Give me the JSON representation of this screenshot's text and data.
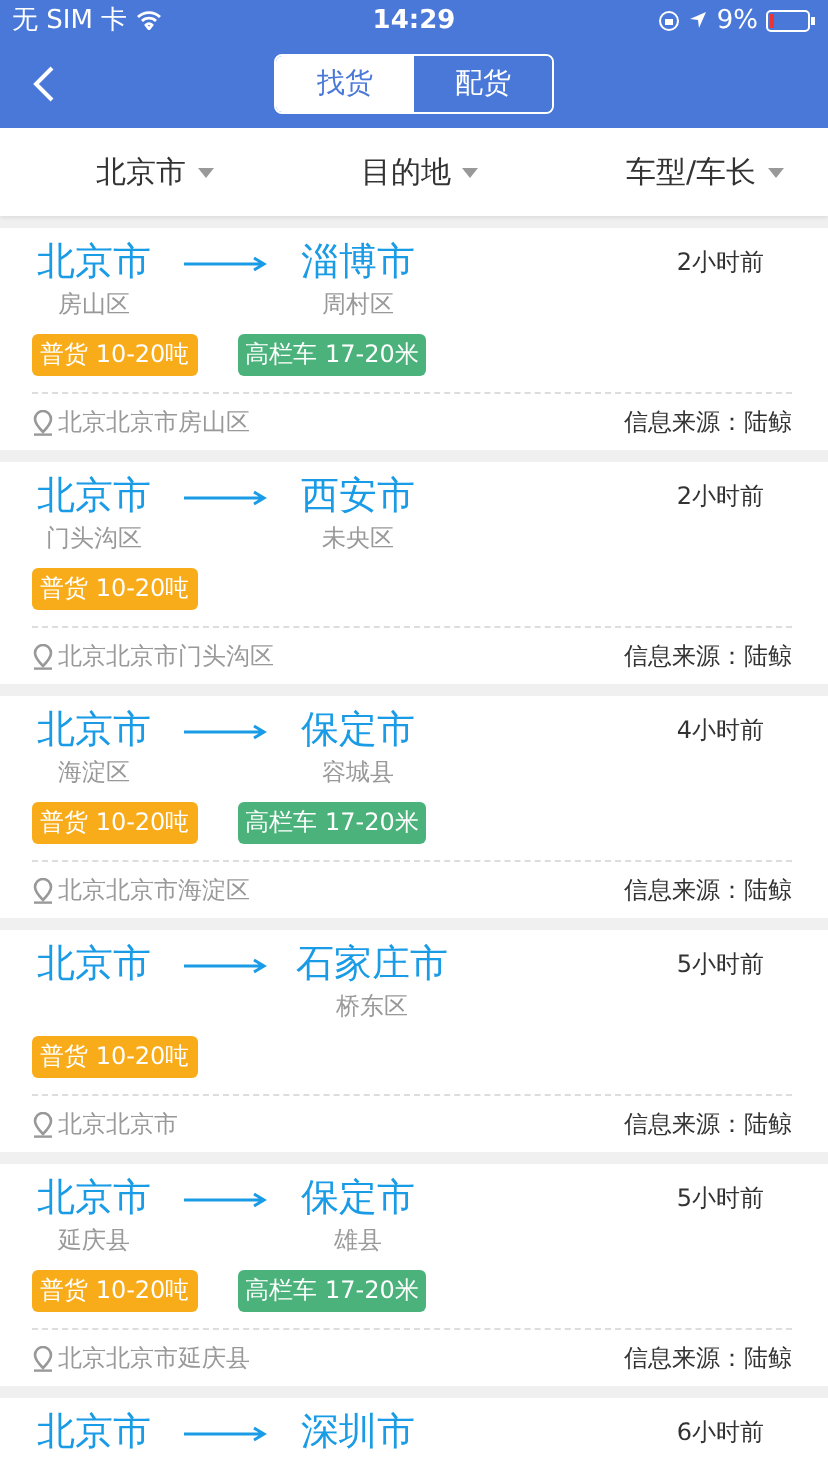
{
  "status_bar": {
    "carrier": "无 SIM 卡",
    "time": "14:29",
    "battery": "9%"
  },
  "nav": {
    "tabs": [
      {
        "label": "找货",
        "selected": true
      },
      {
        "label": "配货",
        "selected": false
      }
    ]
  },
  "filters": [
    {
      "label": "北京市"
    },
    {
      "label": "目的地"
    },
    {
      "label": "车型/车长"
    }
  ],
  "listings": [
    {
      "origin": {
        "city": "北京市",
        "district": "房山区"
      },
      "destination": {
        "city": "淄博市",
        "district": "周村区"
      },
      "time": "2小时前",
      "tags": [
        {
          "kind": "cargo",
          "text": "普货 10-20吨"
        },
        {
          "kind": "truck",
          "text": "高栏车 17-20米"
        }
      ],
      "address": "北京北京市房山区",
      "source": "信息来源：陆鲸"
    },
    {
      "origin": {
        "city": "北京市",
        "district": "门头沟区"
      },
      "destination": {
        "city": "西安市",
        "district": "未央区"
      },
      "time": "2小时前",
      "tags": [
        {
          "kind": "cargo",
          "text": "普货 10-20吨"
        }
      ],
      "address": "北京北京市门头沟区",
      "source": "信息来源：陆鲸"
    },
    {
      "origin": {
        "city": "北京市",
        "district": "海淀区"
      },
      "destination": {
        "city": "保定市",
        "district": "容城县"
      },
      "time": "4小时前",
      "tags": [
        {
          "kind": "cargo",
          "text": "普货 10-20吨"
        },
        {
          "kind": "truck",
          "text": "高栏车 17-20米"
        }
      ],
      "address": "北京北京市海淀区",
      "source": "信息来源：陆鲸"
    },
    {
      "origin": {
        "city": "北京市"
      },
      "destination": {
        "city": "石家庄市",
        "district": "桥东区"
      },
      "time": "5小时前",
      "tags": [
        {
          "kind": "cargo",
          "text": "普货 10-20吨"
        }
      ],
      "address": "北京北京市",
      "source": "信息来源：陆鲸"
    },
    {
      "origin": {
        "city": "北京市",
        "district": "延庆县"
      },
      "destination": {
        "city": "保定市",
        "district": "雄县"
      },
      "time": "5小时前",
      "tags": [
        {
          "kind": "cargo",
          "text": "普货 10-20吨"
        },
        {
          "kind": "truck",
          "text": "高栏车 17-20米"
        }
      ],
      "address": "北京北京市延庆县",
      "source": "信息来源：陆鲸"
    },
    {
      "origin": {
        "city": "北京市"
      },
      "destination": {
        "city": "深圳市"
      },
      "time": "6小时前"
    }
  ]
}
